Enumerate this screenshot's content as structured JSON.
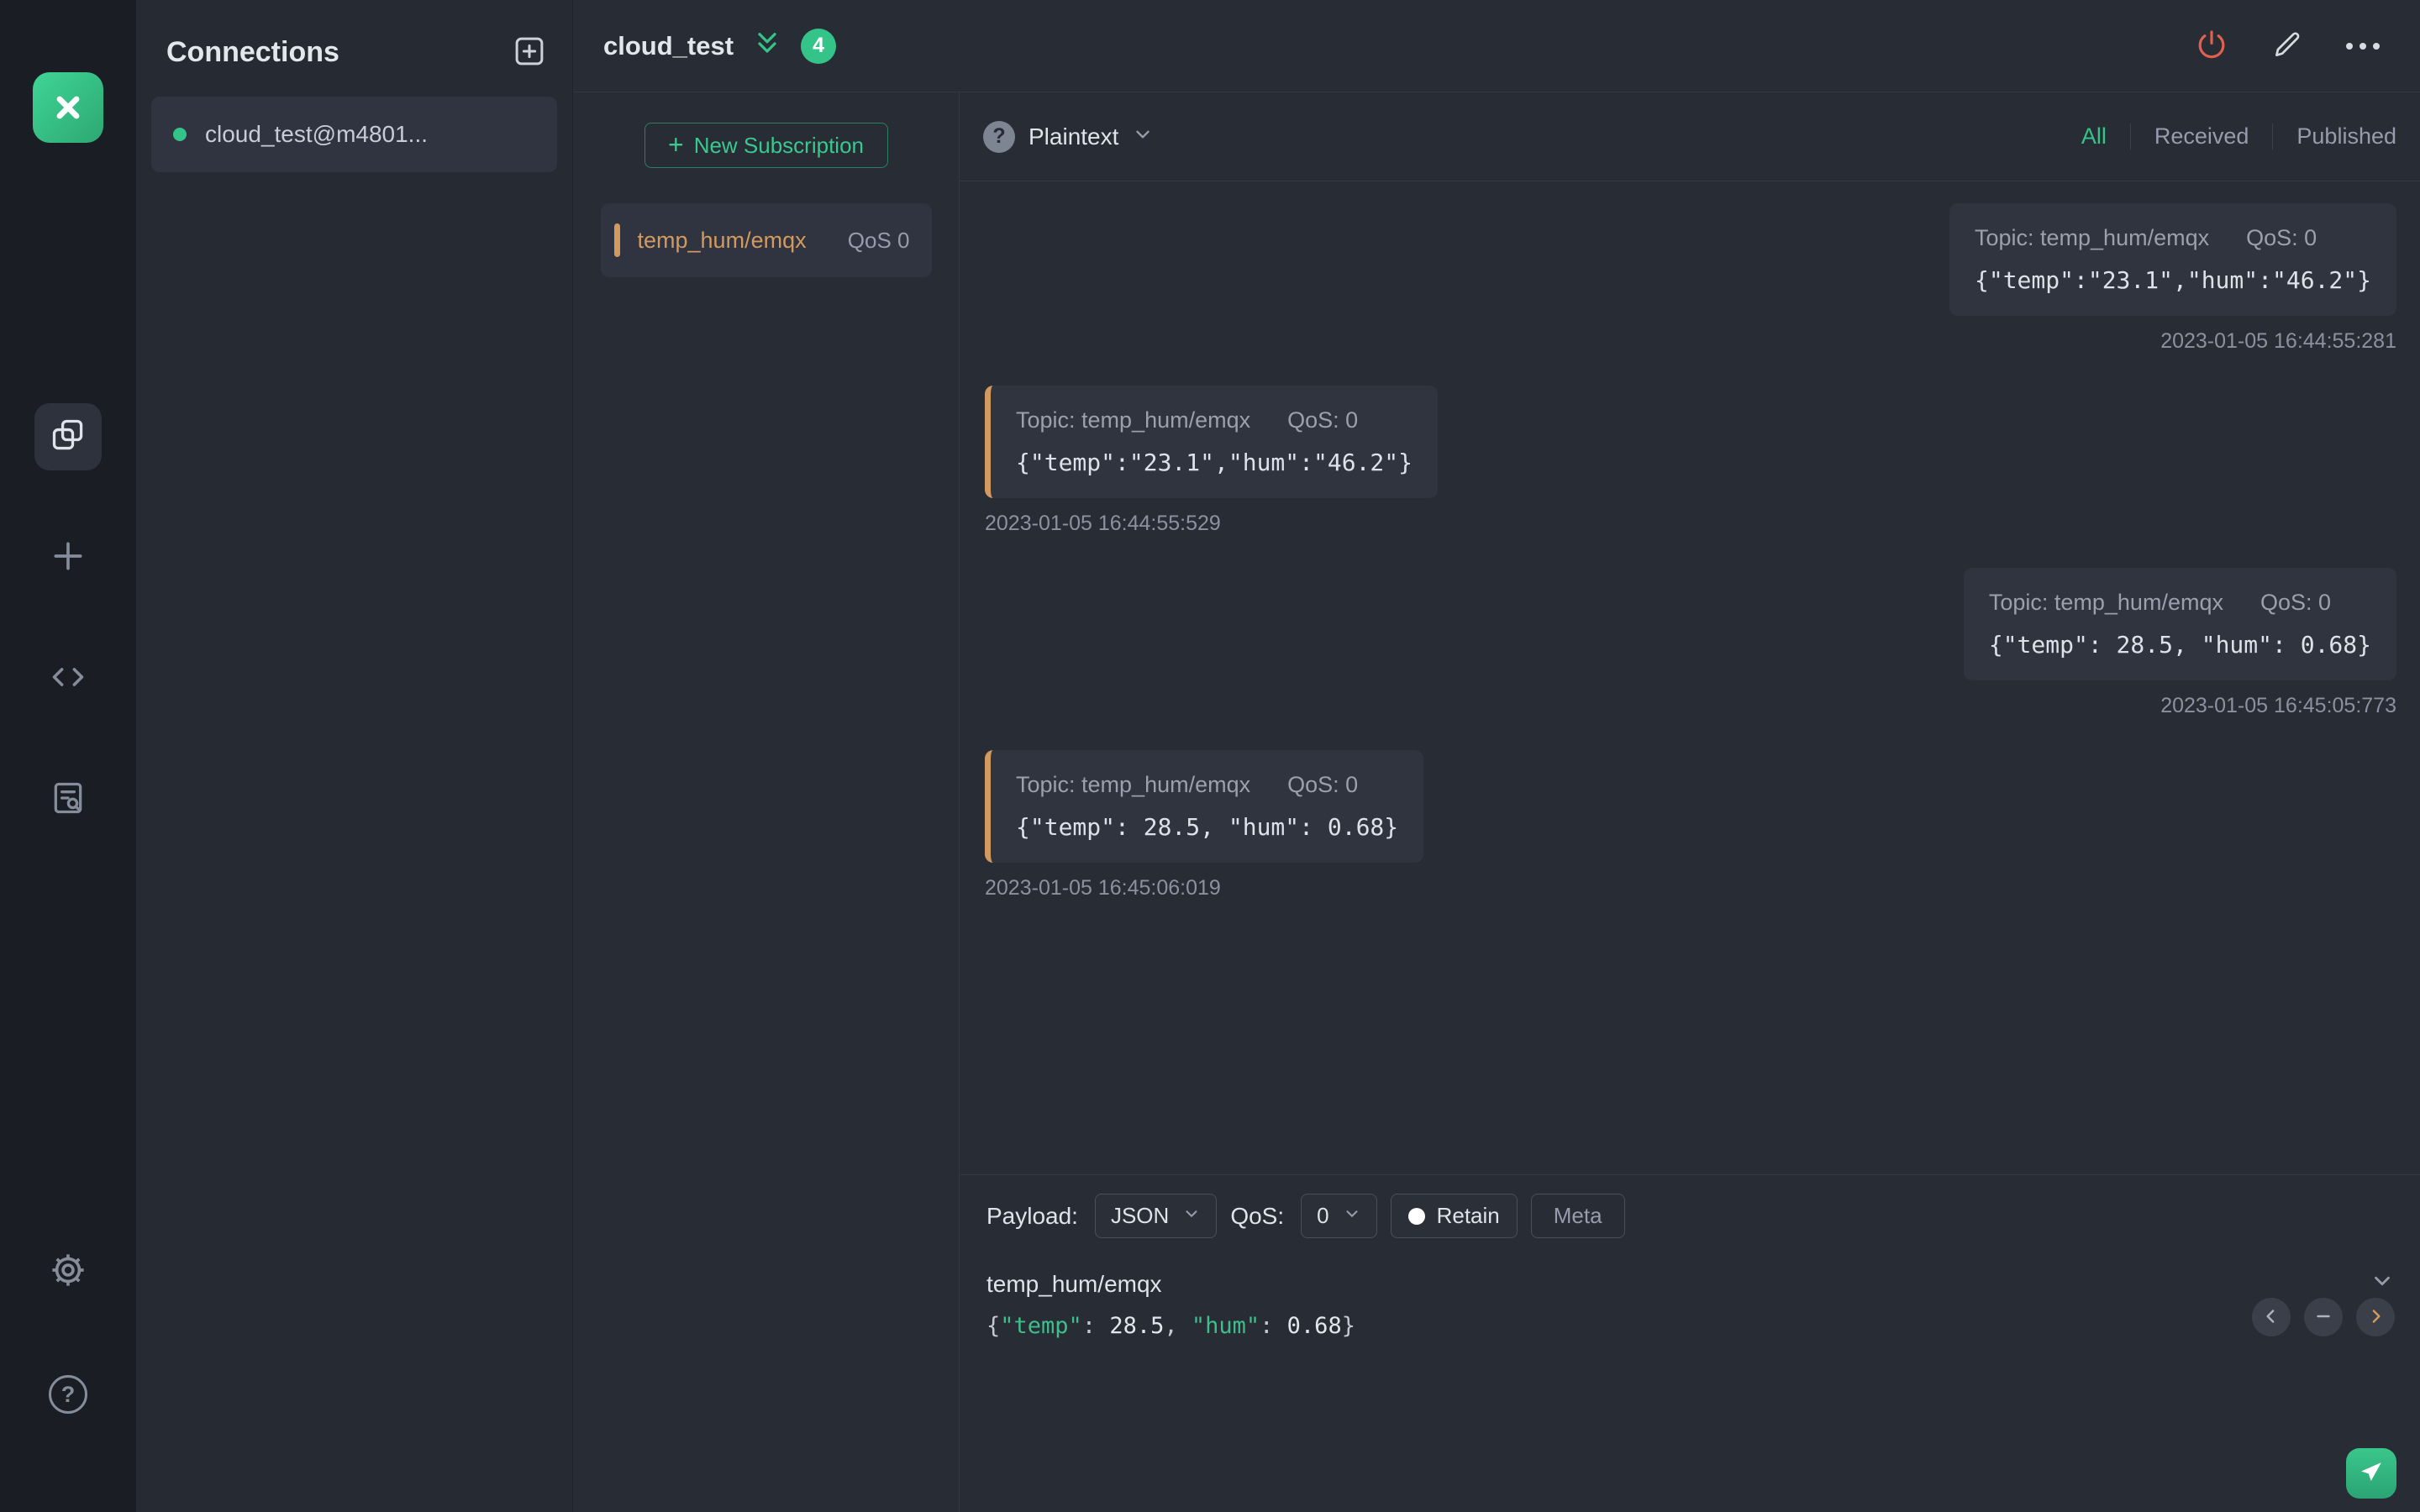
{
  "icons": {
    "help_glyph": "?",
    "plus_glyph": "+"
  },
  "colors": {
    "accent_green": "#34c388",
    "accent_orange": "#d29a5e",
    "power_red": "#e0614f"
  },
  "connections_panel": {
    "title": "Connections",
    "items": [
      {
        "name": "cloud_test@m4801..."
      }
    ]
  },
  "topbar": {
    "title": "cloud_test",
    "badge": "4"
  },
  "subscriptions": {
    "new_button_label": "New Subscription",
    "items": [
      {
        "topic": "temp_hum/emqx",
        "qos": "QoS 0"
      }
    ]
  },
  "messages": {
    "format_label": "Plaintext",
    "filters": [
      {
        "label": "All"
      },
      {
        "label": "Received"
      },
      {
        "label": "Published"
      }
    ],
    "items": [
      {
        "direction": "published",
        "topic_label": "Topic: temp_hum/emqx",
        "qos_label": "QoS: 0",
        "payload": "{\"temp\":\"23.1\",\"hum\":\"46.2\"}",
        "time": "2023-01-05 16:44:55:281"
      },
      {
        "direction": "received",
        "topic_label": "Topic: temp_hum/emqx",
        "qos_label": "QoS: 0",
        "payload": "{\"temp\":\"23.1\",\"hum\":\"46.2\"}",
        "time": "2023-01-05 16:44:55:529"
      },
      {
        "direction": "published",
        "topic_label": "Topic: temp_hum/emqx",
        "qos_label": "QoS: 0",
        "payload": "{\"temp\": 28.5, \"hum\": 0.68}",
        "time": "2023-01-05 16:45:05:773"
      },
      {
        "direction": "received",
        "topic_label": "Topic: temp_hum/emqx",
        "qos_label": "QoS: 0",
        "payload": "{\"temp\": 28.5, \"hum\": 0.68}",
        "time": "2023-01-05 16:45:06:019"
      }
    ]
  },
  "publish": {
    "payload_label": "Payload:",
    "format_value": "JSON",
    "qos_label": "QoS:",
    "qos_value": "0",
    "retain_label": "Retain",
    "meta_label": "Meta",
    "topic": "temp_hum/emqx",
    "editor_tokens": [
      {
        "t": "{"
      },
      {
        "t": "\"temp\""
      },
      {
        "t": ": "
      },
      {
        "t": "28.5"
      },
      {
        "t": ", "
      },
      {
        "t": "\"hum\""
      },
      {
        "t": ": "
      },
      {
        "t": "0.68"
      },
      {
        "t": "}"
      }
    ]
  }
}
